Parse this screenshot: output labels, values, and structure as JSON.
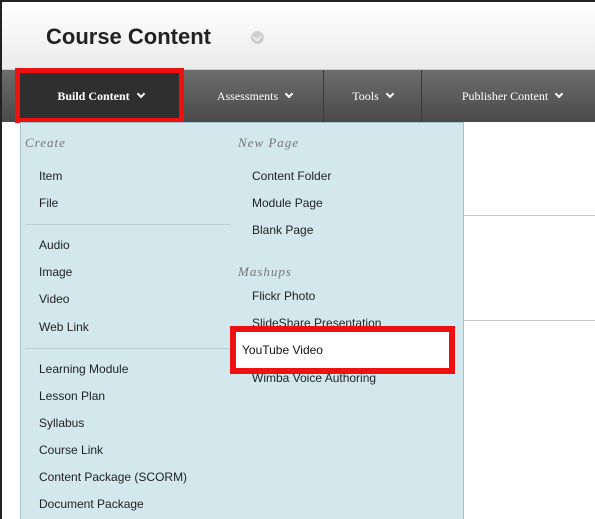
{
  "header": {
    "title": "Course Content"
  },
  "toolbar": {
    "build_content": "Build Content",
    "assessments": "Assessments",
    "tools": "Tools",
    "publisher_content": "Publisher Content"
  },
  "menu": {
    "create_heading": "Create",
    "create_items": [
      "Item",
      "File",
      "Audio",
      "Image",
      "Video",
      "Web Link",
      "Learning Module",
      "Lesson Plan",
      "Syllabus",
      "Course Link",
      "Content Package (SCORM)",
      "Document Package"
    ],
    "new_page_heading": "New Page",
    "new_page_items": [
      "Content Folder",
      "Module Page",
      "Blank Page"
    ],
    "mashups_heading": "Mashups",
    "mashups_items": [
      "Flickr Photo",
      "SlideShare Presentation",
      "YouTube Video",
      "Wimba Voice Authoring"
    ]
  },
  "colors": {
    "highlight": "#ee1111",
    "menu_bg": "#d3e8ec",
    "toolbar": "#4a4a4a"
  }
}
